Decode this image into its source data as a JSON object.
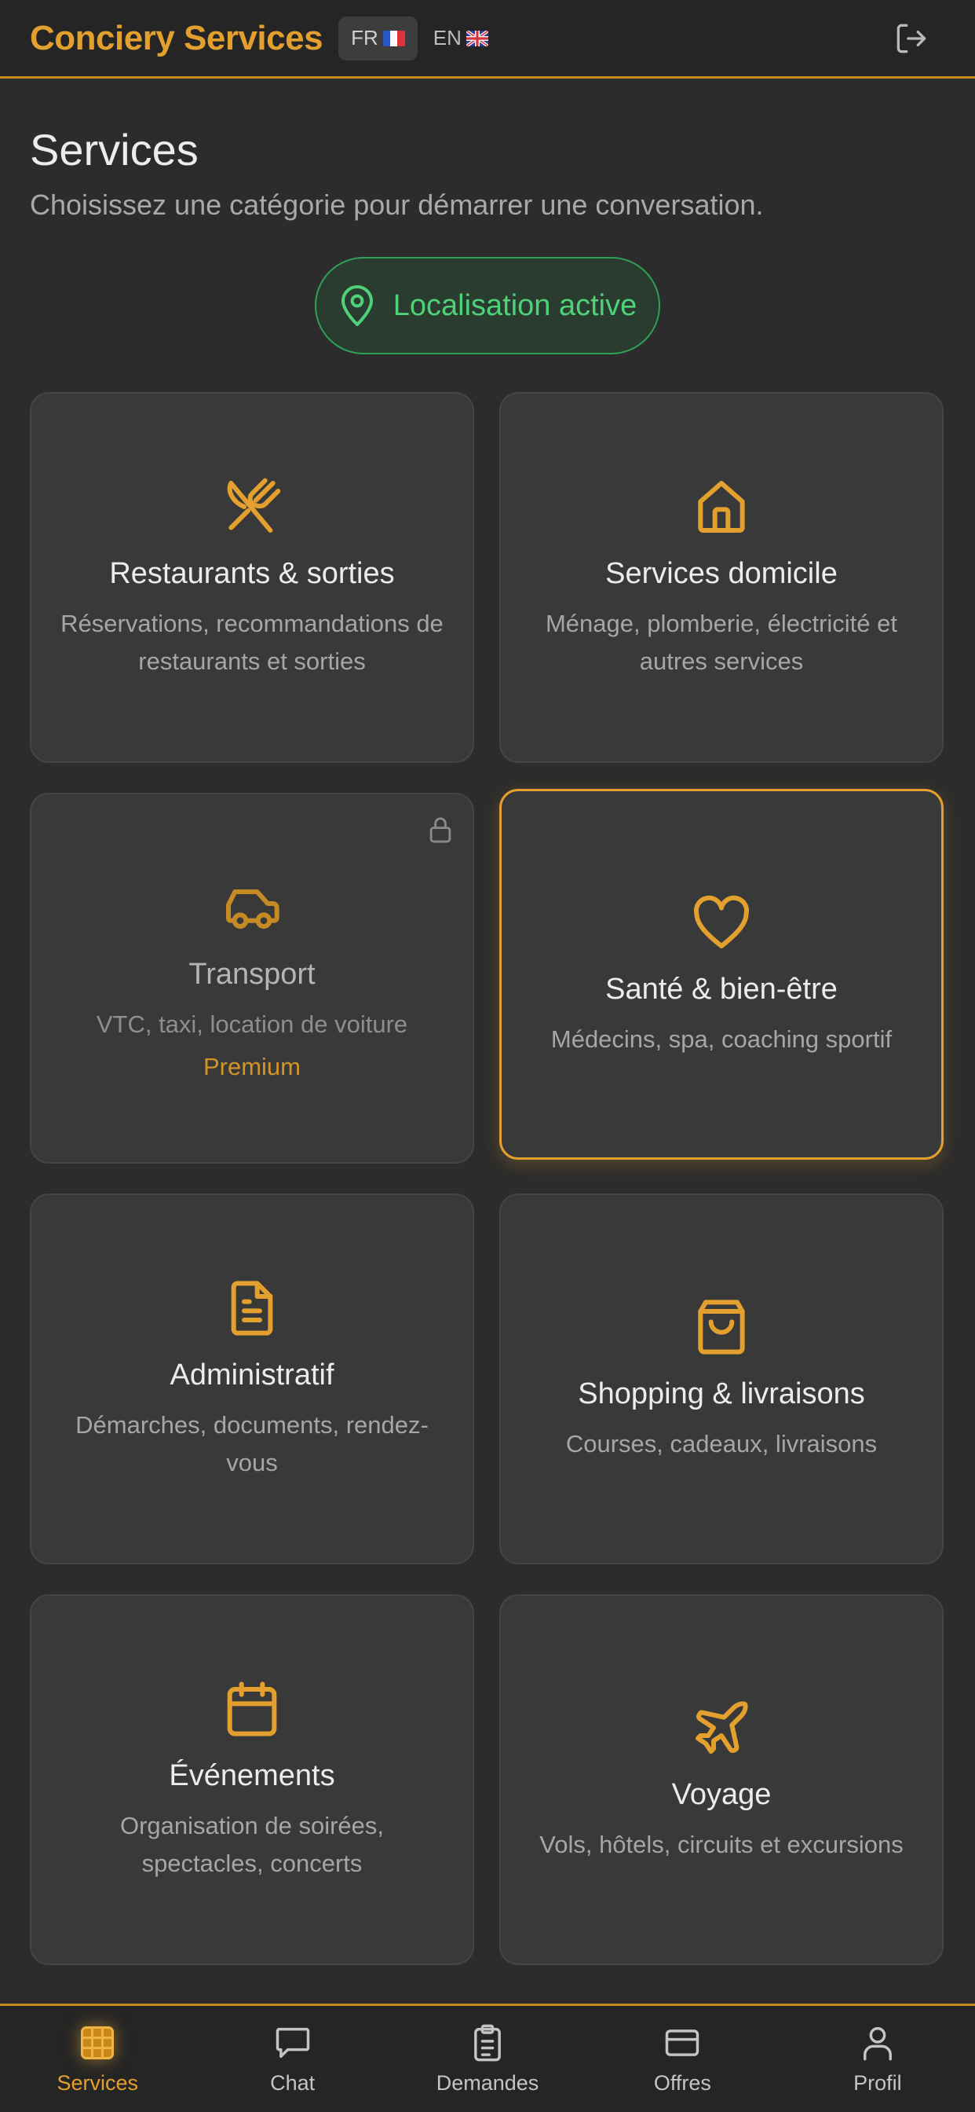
{
  "header": {
    "brand": "Conciery Services",
    "lang_fr": "FR",
    "lang_en": "EN",
    "logout_icon": "logout-icon"
  },
  "page": {
    "title": "Services",
    "subtitle": "Choisissez une catégorie pour démarrer une conversation."
  },
  "location": {
    "label": "Localisation active",
    "icon": "map-pin-icon"
  },
  "categories": [
    {
      "title": "Restaurants & sorties",
      "desc": "Réservations, recommandations de restaurants et sorties",
      "icon": "utensils-icon"
    },
    {
      "title": "Services domicile",
      "desc": "Ménage, plomberie, électricité et autres services",
      "icon": "home-icon"
    },
    {
      "title": "Transport",
      "desc": "VTC, taxi, location de voiture",
      "icon": "car-icon",
      "badge": "Premium",
      "locked": true
    },
    {
      "title": "Santé & bien-être",
      "desc": "Médecins, spa, coaching sportif",
      "icon": "heart-icon",
      "highlighted": true
    },
    {
      "title": "Administratif",
      "desc": "Démarches, documents, rendez-vous",
      "icon": "document-icon"
    },
    {
      "title": "Shopping & livraisons",
      "desc": "Courses, cadeaux, livraisons",
      "icon": "shopping-bag-icon"
    },
    {
      "title": "Événements",
      "desc": "Organisation de soirées, spectacles, concerts",
      "icon": "calendar-icon"
    },
    {
      "title": "Voyage",
      "desc": "Vols, hôtels, circuits et excursions",
      "icon": "plane-icon"
    }
  ],
  "nav": [
    {
      "label": "Services",
      "icon": "grid-icon",
      "active": true
    },
    {
      "label": "Chat",
      "icon": "chat-icon"
    },
    {
      "label": "Demandes",
      "icon": "clipboard-icon"
    },
    {
      "label": "Offres",
      "icon": "card-icon"
    },
    {
      "label": "Profil",
      "icon": "user-icon"
    }
  ],
  "colors": {
    "accent": "#e3a02e",
    "background": "#2c2c2c",
    "card": "#393939",
    "success": "#4fd17a"
  }
}
